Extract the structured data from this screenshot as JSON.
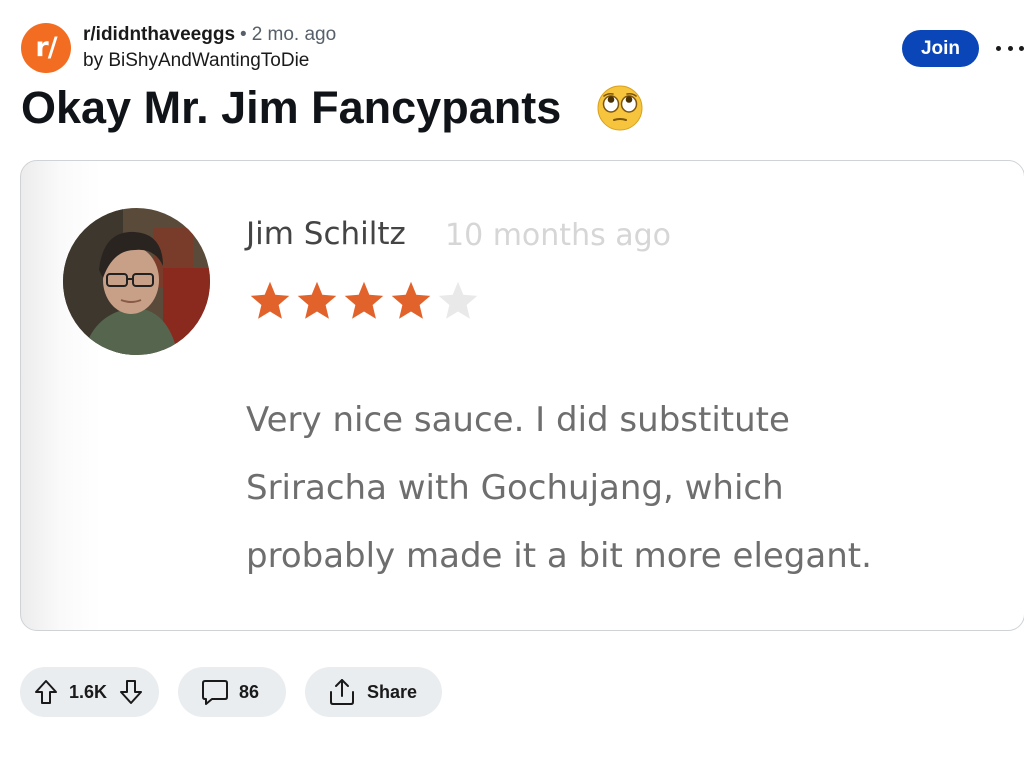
{
  "post": {
    "subreddit_icon_text": "r/",
    "subreddit": "r/ididnthaveeggs",
    "separator": "•",
    "time_ago": "2 mo. ago",
    "author_line": "by BiShyAndWantingToDie",
    "title": "Okay Mr. Jim Fancypants",
    "title_emoji": "face-with-rolling-eyes-icon"
  },
  "header": {
    "join_label": "Join",
    "more_icon": "more-options-icon"
  },
  "review": {
    "reviewer_name": "Jim Schiltz",
    "time_ago": "10 months ago",
    "rating": 4,
    "rating_max": 5,
    "lines": [
      "Very nice sauce. I did substitute",
      "Sriracha with Gochujang, which",
      "probably made it a bit more elegant."
    ],
    "colors": {
      "star_filled": "#e2622b",
      "star_empty": "#e9e9e9"
    }
  },
  "actions": {
    "upvote_count": "1.6K",
    "comment_count": "86",
    "share_label": "Share"
  },
  "colors": {
    "subreddit_icon_bg": "#f26d21",
    "join_bg": "#0a46b8",
    "pill_bg": "#eaedef"
  }
}
